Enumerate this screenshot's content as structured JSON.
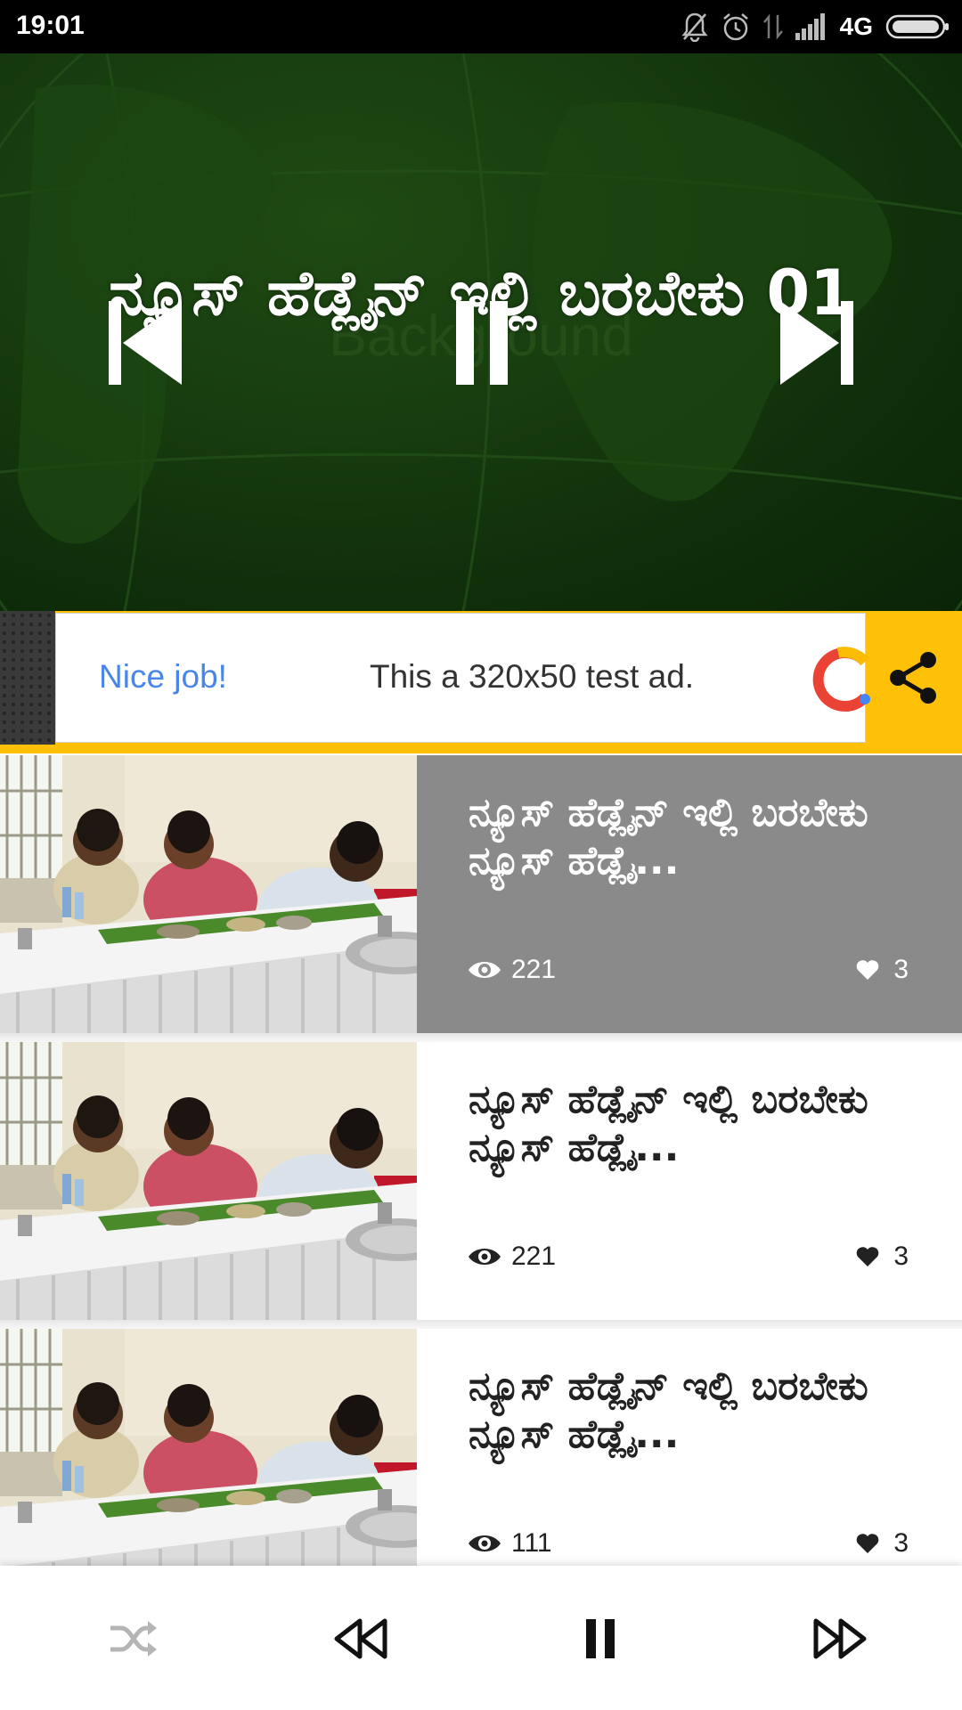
{
  "status_bar": {
    "time": "19:01",
    "network": "4G",
    "icons": [
      "notifications-off-icon",
      "alarm-icon",
      "data-transfer-icon",
      "signal-icon",
      "battery-icon"
    ]
  },
  "hero": {
    "headline": "ನ್ಯೂಸ್ ಹೆಡ್ಲೈನ್ ಇಲ್ಲಿ ಬರಬೇಕು 01",
    "background_word": "Background",
    "controls": [
      "skip-previous-icon",
      "pause-icon",
      "skip-next-icon"
    ],
    "background_color": "#183e10"
  },
  "ad": {
    "label": "Nice job!",
    "text": "This a 320x50 test ad.",
    "label_color": "#4a86e8",
    "share_icon": "share-icon",
    "accent_color": "#ffc107"
  },
  "news": [
    {
      "title": "ನ್ಯೂಸ್ ಹೆಡ್ಲೈನ್ ಇಲ್ಲಿ ಬರಬೇಕು ನ್ಯೂಸ್ ಹೆಡ್ಲೈ...",
      "views": "221",
      "likes": "3",
      "active": true
    },
    {
      "title": "ನ್ಯೂಸ್ ಹೆಡ್ಲೈನ್ ಇಲ್ಲಿ ಬರಬೇಕು ನ್ಯೂಸ್ ಹೆಡ್ಲೈ...",
      "views": "221",
      "likes": "3",
      "active": false
    },
    {
      "title": "ನ್ಯೂಸ್ ಹೆಡ್ಲೈನ್ ಇಲ್ಲಿ ಬರಬೇಕು ನ್ಯೂಸ್ ಹೆಡ್ಲೈ...",
      "views": "111",
      "likes": "3",
      "active": false
    }
  ],
  "player": {
    "controls": [
      "shuffle-icon",
      "rewind-icon",
      "pause-icon",
      "fast-forward-icon"
    ],
    "shuffle_enabled": false
  }
}
